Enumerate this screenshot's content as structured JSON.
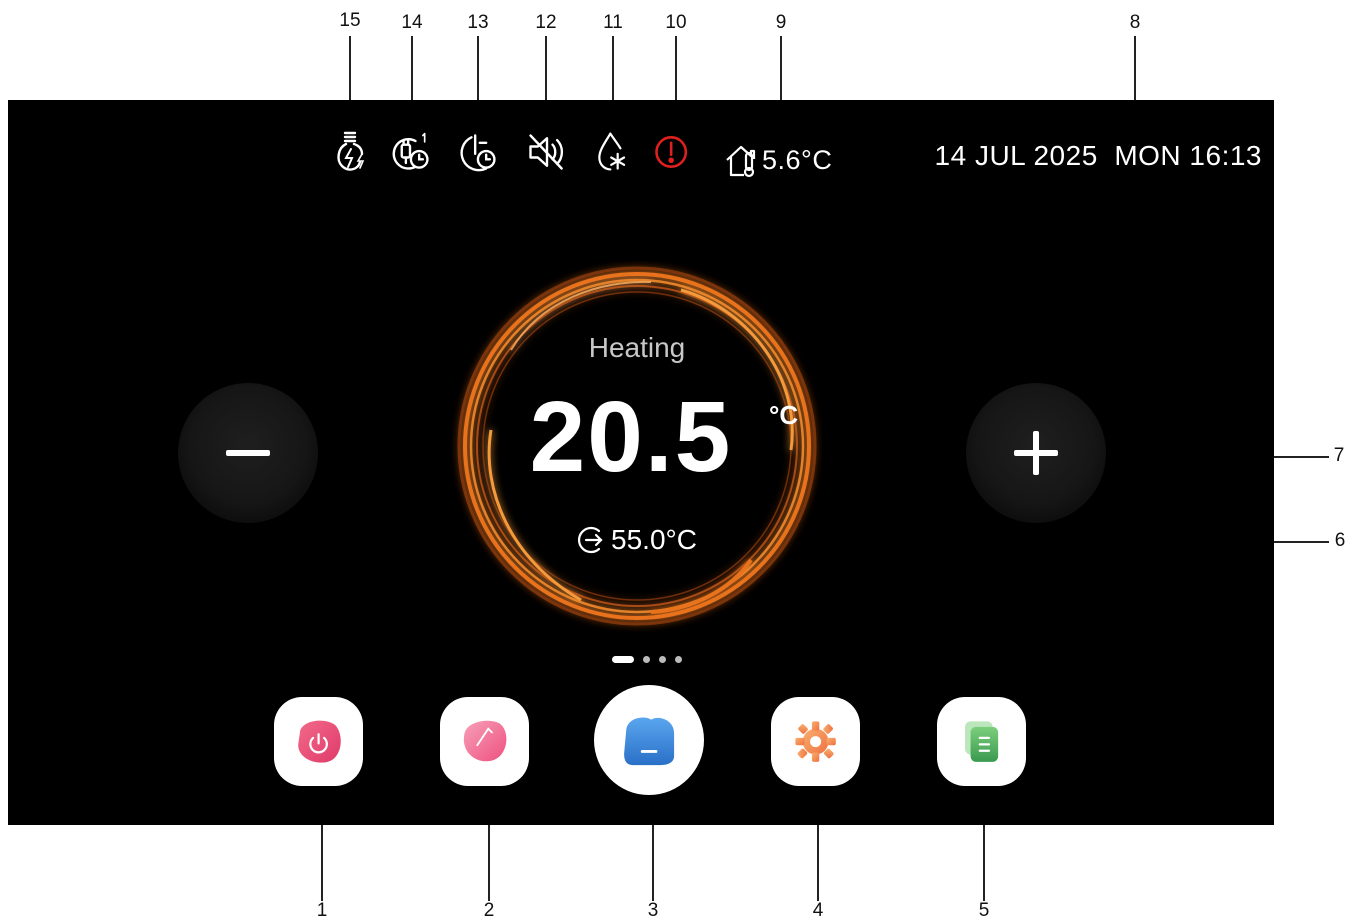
{
  "callouts": {
    "top": [
      "15",
      "14",
      "13",
      "12",
      "11",
      "10",
      "9",
      "8"
    ],
    "right": [
      "7",
      "6"
    ],
    "bottom": [
      "1",
      "2",
      "3",
      "4",
      "5"
    ]
  },
  "status_bar": {
    "icons": [
      "electric-heater-icon",
      "timer-1-icon",
      "night-schedule-icon",
      "mute-icon",
      "defrost-icon",
      "alarm-icon"
    ],
    "alarm_color": "#e0201e",
    "outdoor_temp": "5.6°C",
    "datetime": "14 JUL 2025  MON 16:13"
  },
  "thermostat": {
    "mode": "Heating",
    "setpoint": "20.5",
    "unit": "°C",
    "water_temp": "55.0°C",
    "ring_color": "#e8731e"
  },
  "controls": {
    "minus_icon": "minus-icon",
    "plus_icon": "plus-icon"
  },
  "pager": {
    "pages": 4,
    "active": 0
  },
  "dock": [
    {
      "name": "power-button",
      "icon": "power-icon",
      "color": "#e8467a"
    },
    {
      "name": "mode-button",
      "icon": "mode-icon",
      "color": "#f07090"
    },
    {
      "name": "home-button",
      "icon": "home-icon",
      "color": "#3a88d8"
    },
    {
      "name": "settings-button",
      "icon": "gear-icon",
      "color": "#f08040"
    },
    {
      "name": "menu-button",
      "icon": "list-icon",
      "color": "#4cb060"
    }
  ]
}
